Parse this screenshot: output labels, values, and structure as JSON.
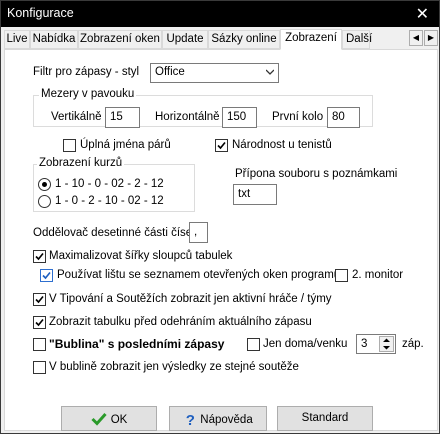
{
  "window": {
    "title": "Konfigurace",
    "close_glyph": "✕"
  },
  "tabs": [
    {
      "label": "Live"
    },
    {
      "label": "Nabídka"
    },
    {
      "label": "Zobrazení oken"
    },
    {
      "label": "Update"
    },
    {
      "label": "Sázky online"
    },
    {
      "label": "Zobrazení",
      "active": true
    },
    {
      "label": "Další"
    }
  ],
  "tab_scroll": {
    "left": "◀",
    "right": "▶"
  },
  "filter": {
    "label": "Filtr pro zápasy - styl",
    "value": "Office"
  },
  "spider": {
    "group_label": "Mezery v pavouku",
    "vertical_label": "Vertikálně",
    "vertical_value": "15",
    "horizontal_label": "Horizontálně",
    "horizontal_value": "150",
    "first_round_label": "První kolo",
    "first_round_value": "80"
  },
  "full_names": {
    "label": "Úplná jména párů",
    "checked": false
  },
  "nationality": {
    "label": "Národnost u tenistů",
    "checked": true
  },
  "odds_display": {
    "group_label": "Zobrazení kurzů",
    "option1": "1 - 10 - 0 - 02 - 2 - 12",
    "option2": "1 - 0 - 2 - 10 - 02 - 12"
  },
  "notes_suffix": {
    "label": "Přípona souboru s poznámkami",
    "value": "txt"
  },
  "decimal_sep": {
    "label": "Oddělovač desetinné části čísel",
    "value": ","
  },
  "maximize": {
    "label": "Maximalizovat šířky sloupců tabulek",
    "checked": true
  },
  "use_bar": {
    "label": "Používat lištu se seznamem otevřených oken programu",
    "checked": true
  },
  "second_monitor": {
    "label": "2. monitor",
    "checked": false
  },
  "active_players": {
    "label": "V Tipování a Soutěžích zobrazit jen aktivní hráče / týmy",
    "checked": true
  },
  "show_table": {
    "label": "Zobrazit tabulku před odehráním aktuálního zápasu",
    "checked": true
  },
  "bubble": {
    "label": "\"Bublina\" s posledními zápasy",
    "checked": false
  },
  "home_away": {
    "label": "Jen doma/venku",
    "checked": false,
    "count": "3",
    "suffix": "záp."
  },
  "bubble_same": {
    "label": "V bublině zobrazit jen výsledky ze stejné soutěže",
    "checked": false
  },
  "buttons": {
    "ok": "OK",
    "help": "Nápověda",
    "standard": "Standard"
  },
  "colors": {
    "titlebar": "#000000",
    "ok_check": "#2a9a2a",
    "help_icon": "#1f5fbf"
  }
}
